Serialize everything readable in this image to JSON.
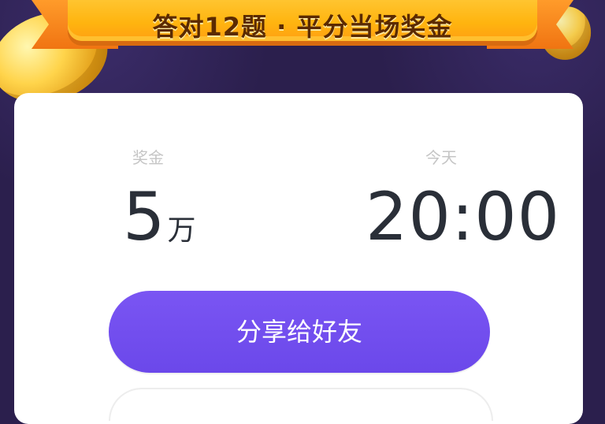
{
  "banner": {
    "title": "答对12题 · 平分当场奖金"
  },
  "stats": {
    "prize": {
      "label": "奖金",
      "value": "5",
      "unit": "万"
    },
    "time": {
      "label": "今天",
      "value": "20:00"
    }
  },
  "actions": {
    "share_label": "分享给好友"
  },
  "colors": {
    "background": "#2b1f4d",
    "card": "#ffffff",
    "primary_button": "#6b48ea",
    "banner": "#ffb40f",
    "banner_text": "#5b2a00",
    "value_text": "#2a2f38",
    "label_text": "#c5c5c5"
  },
  "icons": {
    "decor_left": "gold-coin-icon",
    "decor_right": "gold-coin-icon"
  }
}
